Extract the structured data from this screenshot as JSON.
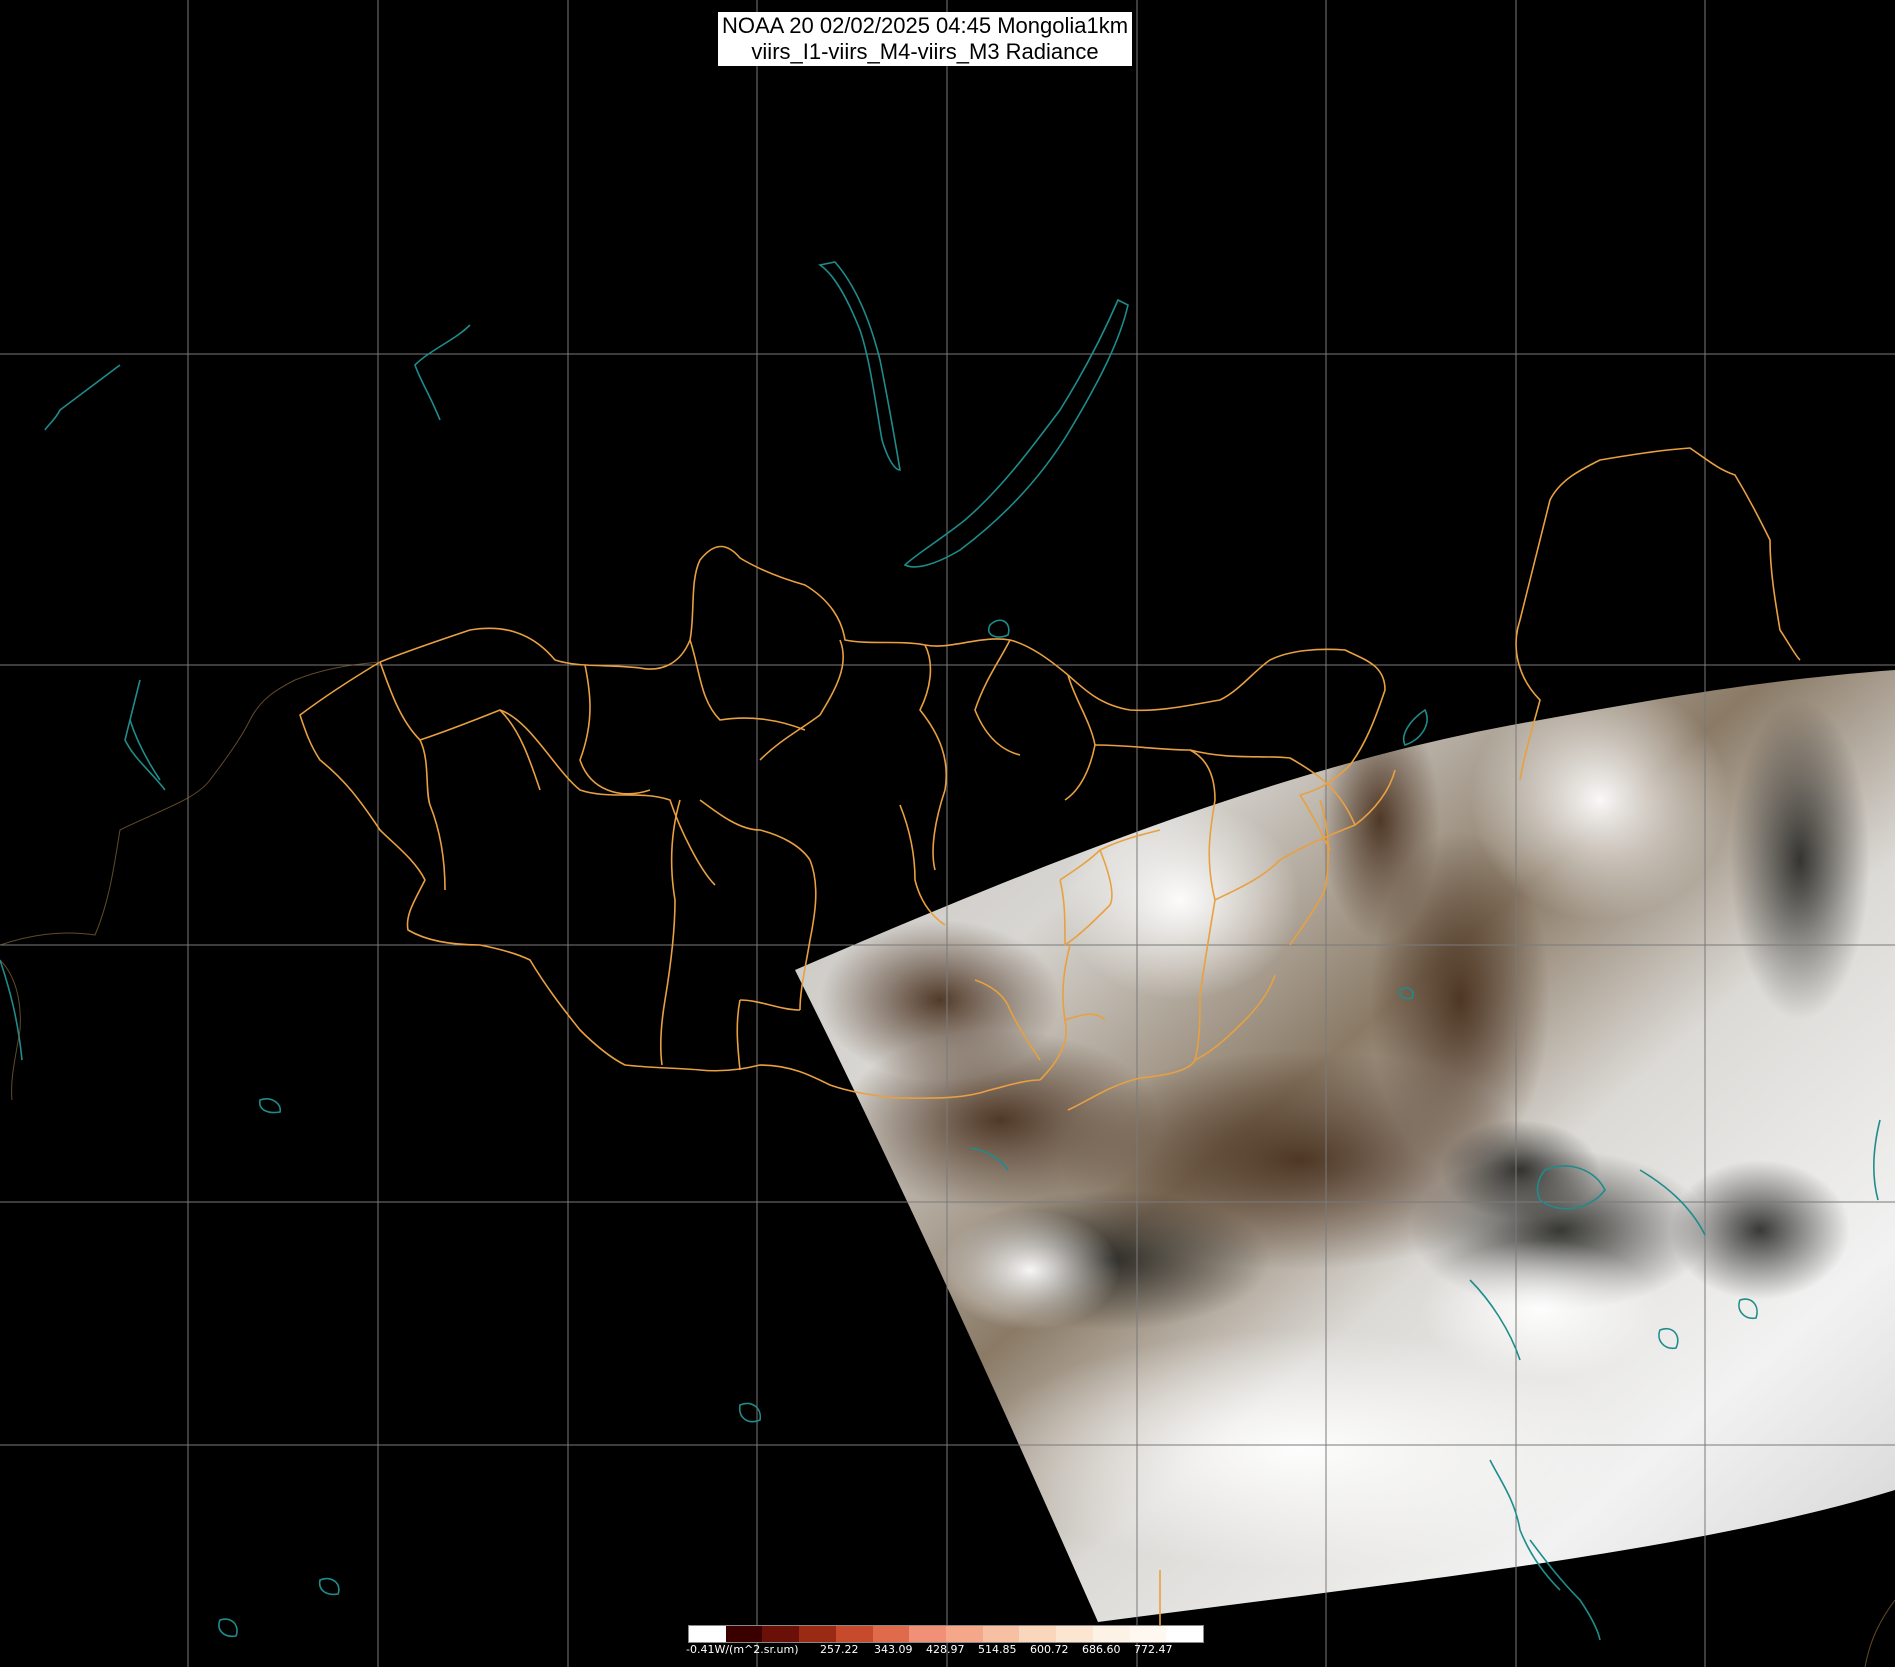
{
  "title": {
    "line1": "NOAA 20 02/02/2025 04:45 Mongolia1km",
    "line2": "viirs_I1-viirs_M4-viirs_M3 Radiance"
  },
  "colorbar": {
    "labels": [
      "-0.41W/(m^2.sr.um)",
      "257.22",
      "343.09",
      "428.97",
      "514.85",
      "600.72",
      "686.60",
      "772.47"
    ],
    "colors": [
      "#ffffff",
      "#3a0000",
      "#6a1008",
      "#9a2a14",
      "#c84a2c",
      "#e06a4c",
      "#f09076",
      "#f4a889",
      "#f8c0a2",
      "#fad6bc",
      "#fce6d2",
      "#fdf2e6",
      "#fff8f0",
      "#ffffff"
    ]
  },
  "colors": {
    "background": "#000000",
    "grid": "#7a7a7a",
    "borders": "#e8a040",
    "coast": "#1f8c8c"
  },
  "icons": [
    "colorbar-icon"
  ]
}
